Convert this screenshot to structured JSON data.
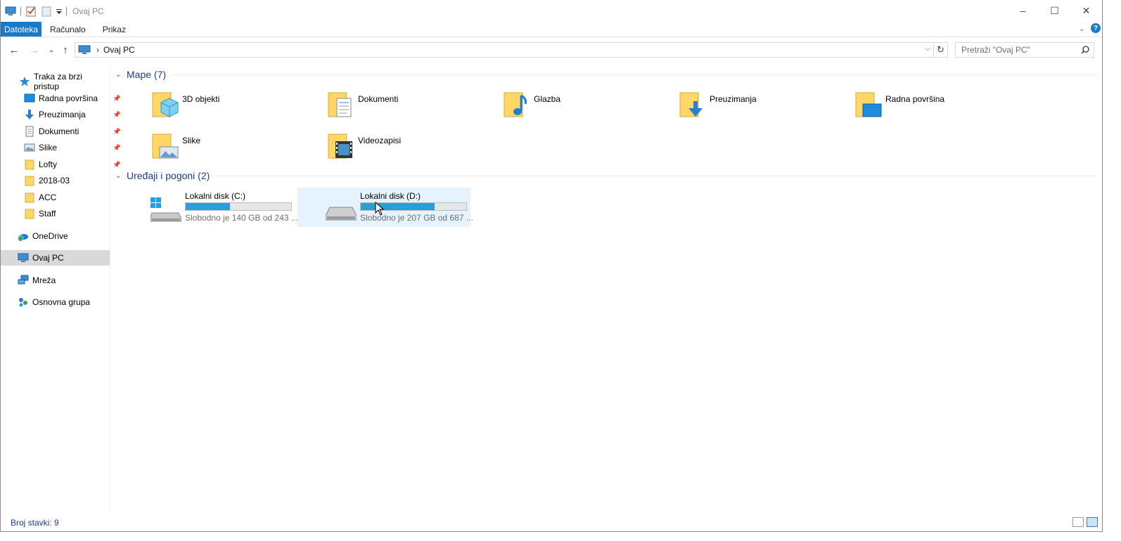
{
  "window": {
    "title": "Ovaj PC",
    "buttons": [
      "–",
      "☐",
      "✕"
    ]
  },
  "ribbon": {
    "tabs": [
      "Datoteka",
      "Računalo",
      "Prikaz"
    ]
  },
  "address": {
    "crumb": "Ovaj PC",
    "search_placeholder": "Pretraži \"Ovaj PC\""
  },
  "sidebar": {
    "quick_access": "Traka za brzi pristup",
    "pinned": [
      {
        "label": "Radna površina",
        "icon": "desktop-icon",
        "pinned": true
      },
      {
        "label": "Preuzimanja",
        "icon": "download-icon",
        "pinned": true
      },
      {
        "label": "Dokumenti",
        "icon": "document-icon",
        "pinned": true
      },
      {
        "label": "Slike",
        "icon": "picture-icon",
        "pinned": true
      },
      {
        "label": "Lofty",
        "icon": "folder-icon",
        "pinned": true
      },
      {
        "label": "2018-03",
        "icon": "folder-icon",
        "pinned": false
      },
      {
        "label": "ACC",
        "icon": "folder-icon",
        "pinned": false
      },
      {
        "label": "Staff",
        "icon": "folder-icon",
        "pinned": false
      }
    ],
    "onedrive": "OneDrive",
    "this_pc": "Ovaj PC",
    "network": "Mreža",
    "homegroup": "Osnovna grupa"
  },
  "content": {
    "folders_header": "Mape (7)",
    "folders": [
      {
        "name": "3D objekti",
        "icon": "3d-objects-icon"
      },
      {
        "name": "Dokumenti",
        "icon": "documents-folder-icon"
      },
      {
        "name": "Glazba",
        "icon": "music-folder-icon"
      },
      {
        "name": "Preuzimanja",
        "icon": "downloads-folder-icon"
      },
      {
        "name": "Radna površina",
        "icon": "desktop-folder-icon"
      },
      {
        "name": "Slike",
        "icon": "pictures-folder-icon"
      },
      {
        "name": "Videozapisi",
        "icon": "videos-folder-icon"
      }
    ],
    "drives_header": "Uređaji i pogoni (2)",
    "drives": [
      {
        "name": "Lokalni disk (C:)",
        "free_text": "Slobodno je 140 GB od 243 ...",
        "used_fraction": 0.42,
        "icon": "windows-drive-icon"
      },
      {
        "name": "Lokalni disk (D:)",
        "free_text": "Slobodno je 207 GB od 687 ...",
        "used_fraction": 0.7,
        "icon": "drive-icon"
      }
    ]
  },
  "status": {
    "count": "Broj stavki: 9"
  },
  "colors": {
    "accent": "#1979ca",
    "bar_fill": "#26a0da",
    "header_text": "#1e3c8c",
    "hover": "#e5f3ff",
    "selected_nav": "#d9d9d9"
  }
}
